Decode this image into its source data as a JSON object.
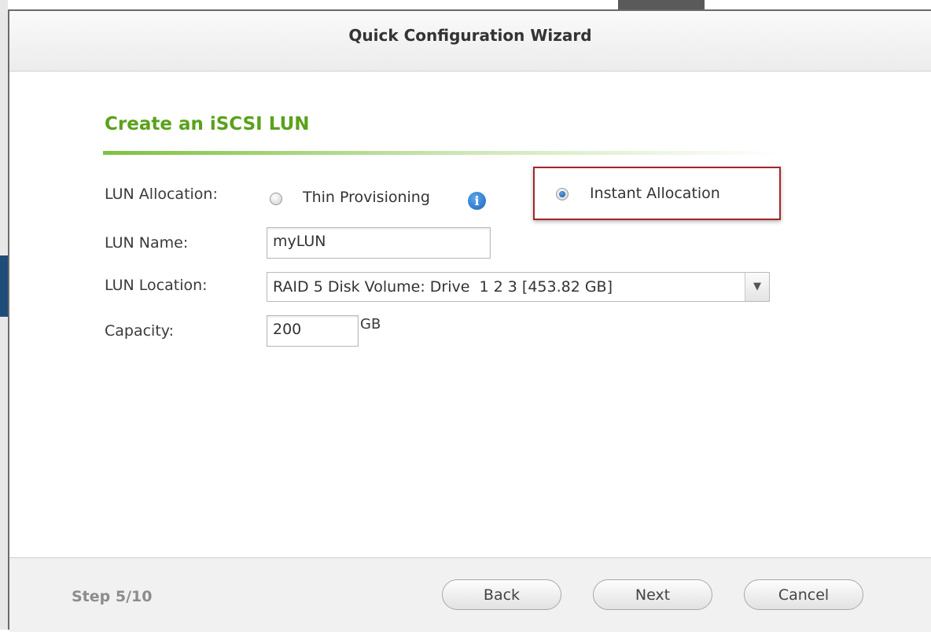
{
  "dialog": {
    "title": "Quick Configuration Wizard"
  },
  "section": {
    "title": "Create an iSCSI LUN"
  },
  "form": {
    "allocation_label": "LUN Allocation:",
    "allocation_options": [
      {
        "label": "Thin Provisioning",
        "checked": false
      },
      {
        "label": "Instant Allocation",
        "checked": true
      }
    ],
    "info_icon_glyph": "i",
    "name_label": "LUN Name:",
    "name_value": "myLUN",
    "location_label": "LUN Location:",
    "location_value": "RAID 5 Disk Volume: Drive  1 2 3 [453.82 GB]",
    "capacity_label": "Capacity:",
    "capacity_value": "200",
    "capacity_unit": "GB"
  },
  "footer": {
    "step": "Step 5/10",
    "back_label": "Back",
    "next_label": "Next",
    "cancel_label": "Cancel"
  },
  "colors": {
    "section_title": "#5aa11b",
    "highlight_border": "#a3252a",
    "radio_checked": "#1a4f96"
  },
  "icons": {
    "info": "info-icon",
    "dropdown": "chevron-down-icon"
  }
}
